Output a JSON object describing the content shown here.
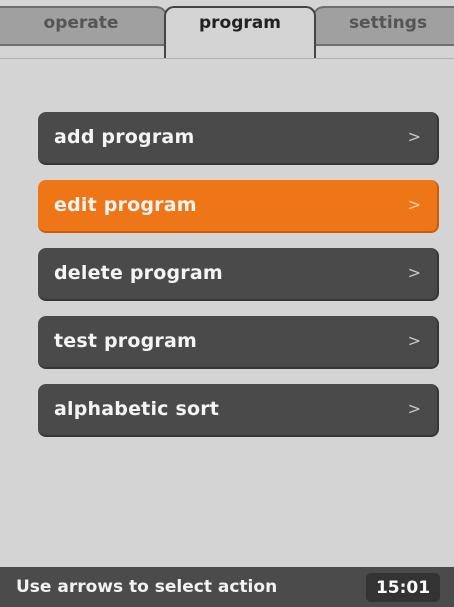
{
  "tabs": [
    {
      "label": "operate"
    },
    {
      "label": "program"
    },
    {
      "label": "settings"
    }
  ],
  "active_tab": "program",
  "menu": {
    "items": [
      {
        "label": "add program",
        "arrow": ">"
      },
      {
        "label": "edit program",
        "arrow": ">"
      },
      {
        "label": "delete program",
        "arrow": ">"
      },
      {
        "label": "test program",
        "arrow": ">"
      },
      {
        "label": "alphabetic sort",
        "arrow": ">"
      }
    ],
    "selected_index": 1
  },
  "status": {
    "hint": "Use arrows to select action",
    "time": "15:01"
  },
  "colors": {
    "background": "#d4d4d4",
    "item": "#4a4a4a",
    "selected": "#ef7617",
    "statusbar": "#4b4b4b"
  }
}
